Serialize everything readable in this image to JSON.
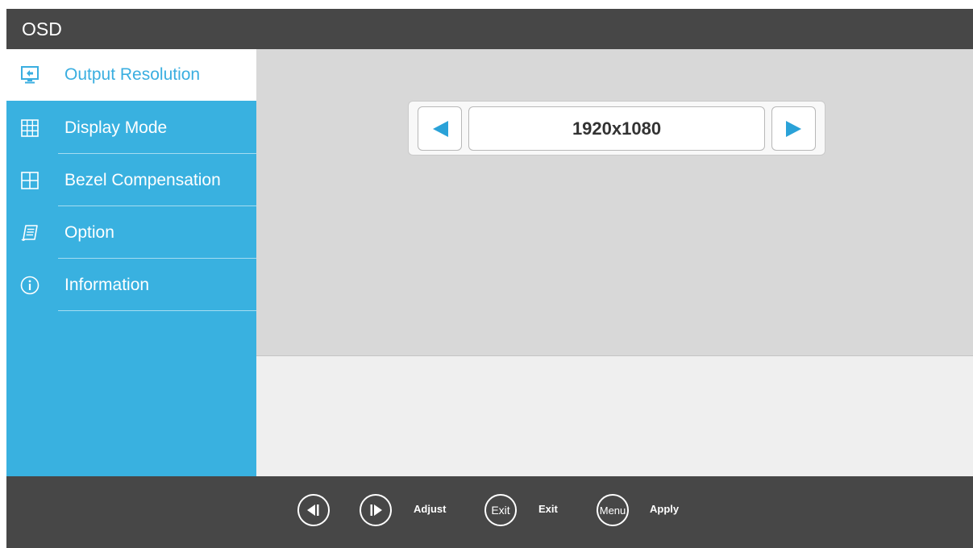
{
  "window": {
    "title": "OSD"
  },
  "sidebar": {
    "items": [
      {
        "label": "Output Resolution",
        "icon": "output-resolution-icon",
        "active": true
      },
      {
        "label": "Display Mode",
        "icon": "grid-icon",
        "active": false
      },
      {
        "label": "Bezel Compensation",
        "icon": "bezel-icon",
        "active": false
      },
      {
        "label": "Option",
        "icon": "option-icon",
        "active": false
      },
      {
        "label": "Information",
        "icon": "info-icon",
        "active": false
      }
    ]
  },
  "selector": {
    "value": "1920x1080",
    "prev_icon": "left-arrow-icon",
    "next_icon": "right-arrow-icon"
  },
  "footer": {
    "adjust_label": "Adjust",
    "exit_key": "Exit",
    "exit_label": "Exit",
    "menu_key": "Menu",
    "apply_label": "Apply"
  },
  "colors": {
    "accent": "#39b1e0",
    "titlebar": "#474747",
    "content": "#d8d8d8",
    "content_lower": "#efefef"
  }
}
